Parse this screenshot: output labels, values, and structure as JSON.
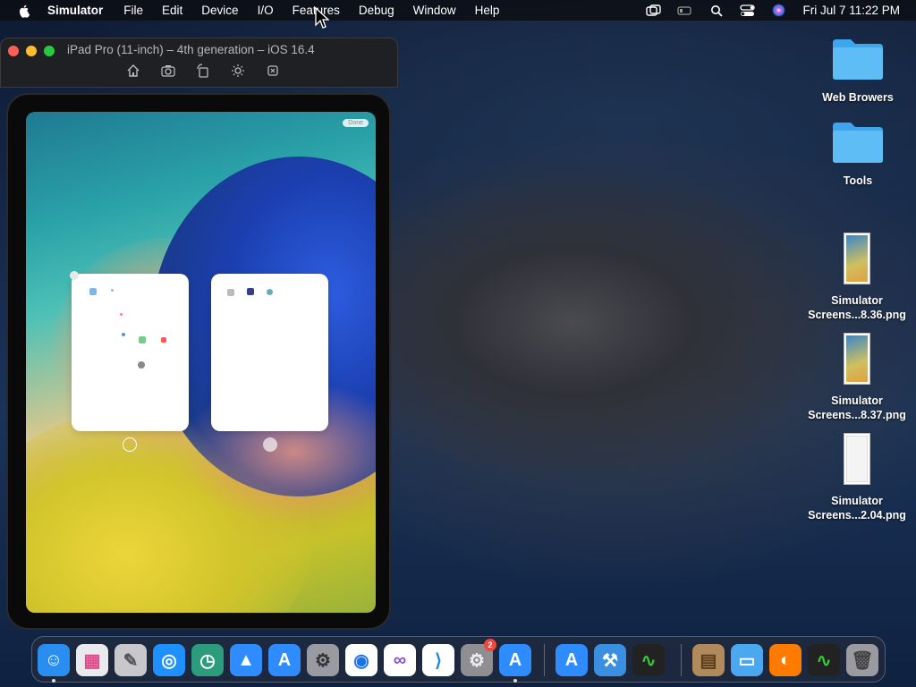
{
  "menubar": {
    "app_name": "Simulator",
    "items": [
      "File",
      "Edit",
      "Device",
      "I/O",
      "Features",
      "Debug",
      "Window",
      "Help"
    ],
    "clock": "Fri Jul 7  11:22 PM",
    "tray_icons": [
      "screen-mirroring-icon",
      "battery-icon",
      "search-icon",
      "control-center-icon",
      "siri-icon"
    ]
  },
  "simulator": {
    "title": "iPad Pro (11-inch) – 4th generation – iOS 16.4",
    "toolbar_icons": [
      "home-icon",
      "screenshot-icon",
      "rotate-icon",
      "appearance-icon",
      "side-button-icon"
    ],
    "done_label": "Done"
  },
  "desktop": {
    "items": [
      {
        "label": "Web Browers",
        "kind": "folder"
      },
      {
        "label": "Tools",
        "kind": "folder"
      },
      {
        "label": "Simulator Screens...8.36.png",
        "kind": "image"
      },
      {
        "label": "Simulator Screens...8.37.png",
        "kind": "image"
      },
      {
        "label": "Simulator Screens...2.04.png",
        "kind": "image"
      }
    ]
  },
  "dock": {
    "items": [
      {
        "name": "finder",
        "color": "#2a8ef0"
      },
      {
        "name": "launchpad",
        "color": "#e9e9ee"
      },
      {
        "name": "script-editor",
        "color": "#c8c8cc"
      },
      {
        "name": "safari",
        "color": "#1e90ff"
      },
      {
        "name": "time-machine",
        "color": "#2c9c7c"
      },
      {
        "name": "ios-app-installer",
        "color": "#2f8cff"
      },
      {
        "name": "app-store",
        "color": "#2f8cff"
      },
      {
        "name": "automator",
        "color": "#9a9aa2"
      },
      {
        "name": "chrome",
        "color": "#ffffff"
      },
      {
        "name": "visual-studio",
        "color": "#ffffff"
      },
      {
        "name": "vs-code",
        "color": "#ffffff"
      },
      {
        "name": "system-settings",
        "color": "#8e8e93",
        "badge": "2"
      },
      {
        "name": "simulator",
        "color": "#2f8cff"
      },
      {
        "name": "app-store-2",
        "color": "#2f8cff"
      },
      {
        "name": "xcode",
        "color": "#3b8fe0"
      },
      {
        "name": "activity-monitor",
        "color": "#222222"
      },
      {
        "name": "archive",
        "color": "#b08a5a"
      },
      {
        "name": "downloads-folder",
        "color": "#4aa8f0"
      },
      {
        "name": "firefox",
        "color": "#ff7b00"
      },
      {
        "name": "activity-monitor-2",
        "color": "#222222"
      },
      {
        "name": "trash",
        "color": "#9a9aa0"
      }
    ]
  }
}
